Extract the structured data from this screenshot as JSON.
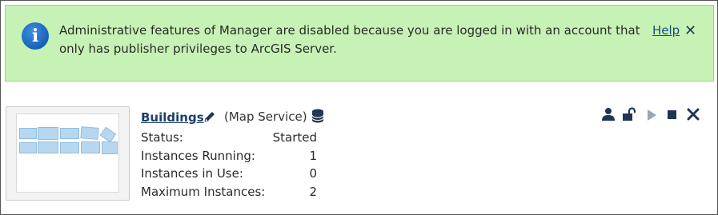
{
  "banner": {
    "message": "Administrative features of Manager are disabled because you are logged in with an account that only has publisher privileges to ArcGIS Server.",
    "help_label": "Help",
    "close_glyph": "✕",
    "info_glyph": "i",
    "background": "#c6f3b5",
    "icon": "info-icon"
  },
  "service": {
    "name": "Buildings",
    "type": "(Map Service)",
    "rows": [
      {
        "label": "Status:",
        "value": "Started"
      },
      {
        "label": "Instances Running:",
        "value": "1"
      },
      {
        "label": "Instances in Use:",
        "value": "0"
      },
      {
        "label": "Maximum Instances:",
        "value": "2"
      }
    ],
    "icons": {
      "edit": "pencil-icon",
      "data_source": "database-icon"
    },
    "actions": [
      {
        "name": "permissions-button",
        "icon": "user-icon"
      },
      {
        "name": "security-button",
        "icon": "unlock-icon"
      },
      {
        "name": "start-button",
        "icon": "play-icon"
      },
      {
        "name": "stop-button",
        "icon": "stop-icon"
      },
      {
        "name": "delete-button",
        "icon": "close-icon"
      }
    ]
  }
}
